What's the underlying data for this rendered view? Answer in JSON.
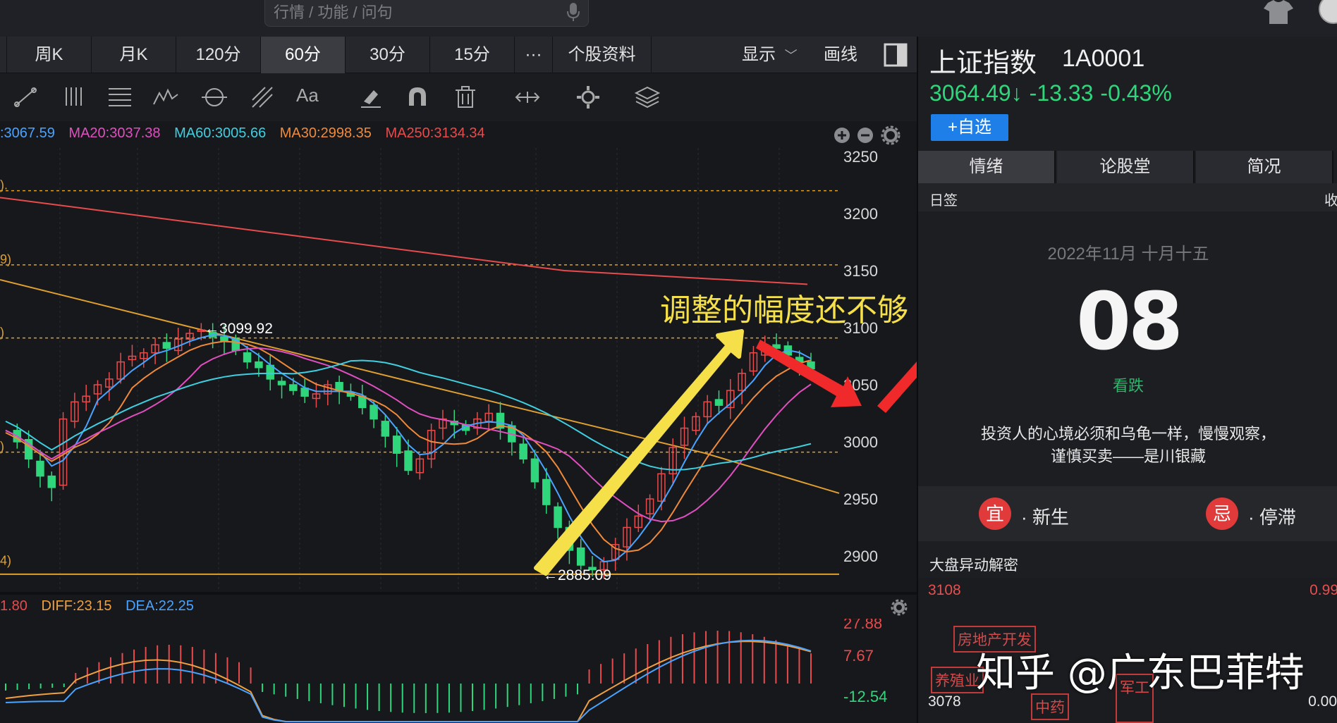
{
  "search": {
    "placeholder": "行情 / 功能 / 问句"
  },
  "period_tabs": [
    "周K",
    "月K",
    "120分",
    "60分",
    "30分",
    "15分",
    "···",
    "个股资料"
  ],
  "active_period": "60分",
  "toolbar": {
    "display_label": "显示",
    "drawline_label": "画线"
  },
  "ma_legend": [
    {
      "label": ":3067.59",
      "color": "#4aa3ff"
    },
    {
      "label": "MA20:3037.38",
      "color": "#e04fbf"
    },
    {
      "label": "MA60:3005.66",
      "color": "#3fcfe0"
    },
    {
      "label": "MA30:2998.35",
      "color": "#f08a3a"
    },
    {
      "label": "MA250:3134.34",
      "color": "#e84b4b"
    }
  ],
  "y_axis_labels": [
    "3250",
    "3200",
    "3150",
    "3100",
    "3050",
    "3000",
    "2950",
    "2900"
  ],
  "left_edge_labels": [
    ").",
    "9)",
    ")",
    ")",
    "4)"
  ],
  "price_annotations": {
    "high": "3099.92",
    "low": "2885.09"
  },
  "annotation_text": "调整的幅度还不够",
  "macd_legend": [
    {
      "label": "1.80",
      "color": "#e84b4b"
    },
    {
      "label": "DIFF:23.15",
      "color": "#f0a040"
    },
    {
      "label": "DEA:22.25",
      "color": "#4aa3ff"
    }
  ],
  "macd_axis": [
    "27.88",
    "7.67",
    "-12.54"
  ],
  "stock": {
    "name": "上证指数",
    "code": "1A0001",
    "price": "3064.49↓",
    "change": "-13.33",
    "pct": "-0.43%",
    "watch_label": "+自选"
  },
  "right_tabs": [
    "情绪",
    "论股堂",
    "简况"
  ],
  "daysign": {
    "label": "日签",
    "right_label": "收",
    "date": "2022年11月 十月十五",
    "day": "08",
    "outlook": "看跌",
    "quote_line1": "投资人的心境必须和乌龟一样，慢慢观察，",
    "quote_line2": "谨慎买卖——是川银藏",
    "good_badge": "宜",
    "good_label": "· 新生",
    "bad_badge": "忌",
    "bad_label": "· 停滞"
  },
  "abnormal": {
    "title": "大盘异动解密",
    "top_left": "3108",
    "top_right": "0.99",
    "bottom_left": "3078",
    "bottom_right": "0.00",
    "tags": [
      "房地产开发",
      "养殖业",
      "中药",
      "军工"
    ]
  },
  "watermark": "知乎 @广东巴菲特",
  "colors": {
    "up": "#e84b4b",
    "down": "#2fd67b",
    "accent": "#1f7fe8",
    "annotation": "#f5e04a"
  }
}
